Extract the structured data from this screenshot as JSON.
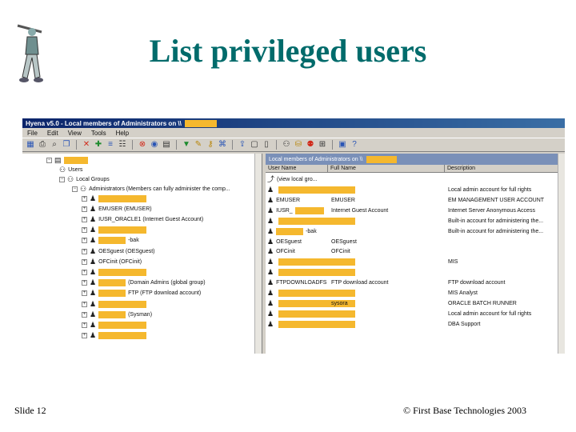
{
  "slide": {
    "title": "List privileged users",
    "slide_number": "Slide 12",
    "copyright": "© First Base Technologies 2003"
  },
  "window": {
    "title": "Hyena v5.0 - Local members of Administrators on \\\\",
    "menu": [
      "File",
      "Edit",
      "View",
      "Tools",
      "Help"
    ]
  },
  "tree": {
    "users_label": "Users",
    "groups_label": "Local Groups",
    "admins_label": "Administrators (Members can fully administer the comp...",
    "members": [
      {
        "label": "",
        "redacted": true
      },
      {
        "label": "EMUSER (EMUSER)"
      },
      {
        "label": "IUSR_ORACLE1 (Internet Guest Account)"
      },
      {
        "label": "",
        "redacted": true
      },
      {
        "label": "-bak",
        "redacted": true
      },
      {
        "label": "OESguest (OESguest)"
      },
      {
        "label": "OFCinit (OFCinit)"
      },
      {
        "label": "",
        "redacted": true
      },
      {
        "label": "(Domain Admins (global group)",
        "redacted": true
      },
      {
        "label": "FTP (FTP download account)",
        "redacted": true
      },
      {
        "label": "",
        "redacted": true
      },
      {
        "label": "(Sysman)",
        "redacted": true
      },
      {
        "label": "",
        "redacted": true
      },
      {
        "label": "",
        "redacted": true
      }
    ]
  },
  "list": {
    "pane_title": "Local members of Administrators on \\\\",
    "columns": [
      "User Name",
      "Full Name",
      "Description"
    ],
    "first_row": "(view local gro...",
    "rows": [
      {
        "name": "",
        "full": "",
        "desc": "Local admin account for full rights"
      },
      {
        "name": "EMUSER",
        "full": "EMUSER",
        "desc": "EM MANAGEMENT USER ACCOUNT"
      },
      {
        "name": "IUSR_",
        "full": "Internet Guest Account",
        "desc": "Internet Server Anonymous Access"
      },
      {
        "name": "",
        "full": "",
        "desc": "Built-in account for administering the..."
      },
      {
        "name": "-bak",
        "full": "",
        "desc": "Built-in account for administering the..."
      },
      {
        "name": "OESguest",
        "full": "OESguest",
        "desc": ""
      },
      {
        "name": "OFCinit",
        "full": "OFCinit",
        "desc": ""
      },
      {
        "name": "",
        "full": "",
        "desc": "MIS"
      },
      {
        "name": "",
        "full": "",
        "desc": ""
      },
      {
        "name": "FTPDOWNLOADFS",
        "full": "FTP download account",
        "desc": "FTP download account"
      },
      {
        "name": "",
        "full": "",
        "desc": "MIS Analyst"
      },
      {
        "name": "",
        "full": "sysora",
        "desc": "ORACLE BATCH RUNNER"
      },
      {
        "name": "",
        "full": "",
        "desc": "Local admin account for full rights"
      },
      {
        "name": "",
        "full": "",
        "desc": "DBA Support"
      }
    ]
  },
  "colors": {
    "title": "#006b6b",
    "redaction": "#f5b82e",
    "titlebar": "#0a246a"
  }
}
